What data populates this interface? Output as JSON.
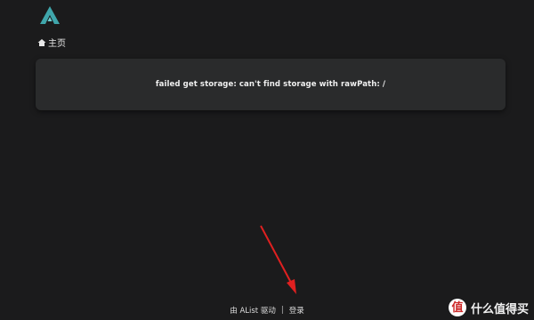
{
  "header": {
    "logo_icon": "alist-logo-icon",
    "logo_color": "#4ab3b8"
  },
  "breadcrumb": {
    "home_icon": "home-icon",
    "home_label": "主页"
  },
  "error": {
    "message": "failed get storage: can't find storage with rawPath: /"
  },
  "footer": {
    "powered_by": "由 AList 驱动",
    "separator": "|",
    "login_label": "登录"
  },
  "annotation": {
    "arrow_color": "#e02020"
  },
  "watermark": {
    "badge_text": "值",
    "text": "什么值得买"
  }
}
